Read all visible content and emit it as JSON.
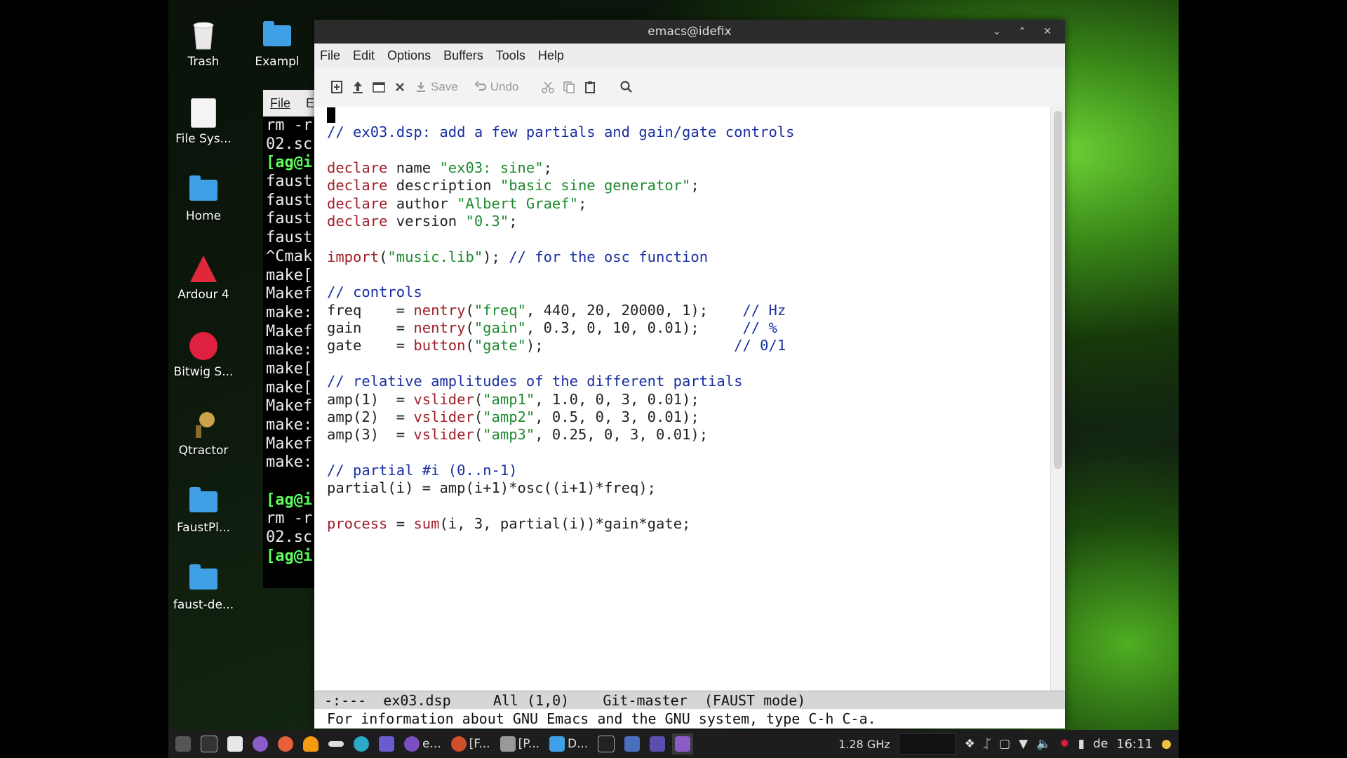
{
  "desktop": {
    "icons": [
      {
        "label": "Trash"
      },
      {
        "label": "Exampl"
      },
      {
        "label": "File Sys..."
      },
      {
        "label": "Home"
      },
      {
        "label": "Ardour 4"
      },
      {
        "label": "Bitwig S..."
      },
      {
        "label": "Qtractor"
      },
      {
        "label": "FaustPl..."
      },
      {
        "label": "faust-de..."
      }
    ]
  },
  "terminal": {
    "menu": [
      "File",
      "E"
    ],
    "lines": [
      "rm -r",
      "02.sc",
      "[ag@i",
      "faust",
      "faust",
      "faust",
      "faust",
      "^Cmak",
      "make[",
      "Makef",
      "make:",
      "Makef",
      "make:",
      "make[",
      "make[",
      "Makef",
      "make:",
      "Makef",
      "make:",
      "",
      "[ag@i",
      "rm -r",
      "02.sc",
      "[ag@i"
    ]
  },
  "emacs": {
    "title": "emacs@idefix",
    "menu": [
      "File",
      "Edit",
      "Options",
      "Buffers",
      "Tools",
      "Help"
    ],
    "toolbar": {
      "save": "Save",
      "undo": "Undo"
    },
    "modeline": "-:---  ex03.dsp     All (1,0)    Git-master  (FAUST mode)",
    "minibuffer": "For information about GNU Emacs and the GNU system, type C-h C-a.",
    "code": {
      "l1": "// ex03.dsp: add a few partials and gain/gate controls",
      "l3a": "declare",
      "l3b": " name ",
      "l3c": "\"ex03: sine\"",
      "l3d": ";",
      "l4a": "declare",
      "l4b": " description ",
      "l4c": "\"basic sine generator\"",
      "l4d": ";",
      "l5a": "declare",
      "l5b": " author ",
      "l5c": "\"Albert Graef\"",
      "l5d": ";",
      "l6a": "declare",
      "l6b": " version ",
      "l6c": "\"0.3\"",
      "l6d": ";",
      "l8a": "import",
      "l8b": "(",
      "l8c": "\"music.lib\"",
      "l8d": "); ",
      "l8e": "// for the osc function",
      "l10": "// controls",
      "l11a": "freq    = ",
      "l11b": "nentry",
      "l11c": "(",
      "l11d": "\"freq\"",
      "l11e": ", 440, 20, 20000, 1);    ",
      "l11f": "// Hz",
      "l12a": "gain    = ",
      "l12b": "nentry",
      "l12c": "(",
      "l12d": "\"gain\"",
      "l12e": ", 0.3, 0, 10, 0.01);     ",
      "l12f": "// %",
      "l13a": "gate    = ",
      "l13b": "button",
      "l13c": "(",
      "l13d": "\"gate\"",
      "l13e": ");                      ",
      "l13f": "// 0/1",
      "l15": "// relative amplitudes of the different partials",
      "l16a": "amp(1)  = ",
      "l16b": "vslider",
      "l16c": "(",
      "l16d": "\"amp1\"",
      "l16e": ", 1.0, 0, 3, 0.01);",
      "l17a": "amp(2)  = ",
      "l17b": "vslider",
      "l17c": "(",
      "l17d": "\"amp2\"",
      "l17e": ", 0.5, 0, 3, 0.01);",
      "l18a": "amp(3)  = ",
      "l18b": "vslider",
      "l18c": "(",
      "l18d": "\"amp3\"",
      "l18e": ", 0.25, 0, 3, 0.01);",
      "l20": "// partial #i (0..n-1)",
      "l21": "partial(i) = amp(i+1)*osc((i+1)*freq);",
      "l23a": "process",
      "l23b": " = ",
      "l23c": "sum",
      "l23d": "(i, 3, partial(i))*gain*gate;"
    }
  },
  "taskbar": {
    "tasks": [
      "e...",
      "[F...",
      "[P...",
      "D..."
    ],
    "cpu": "1.28 GHz",
    "lang": "de",
    "clock": "16:11"
  }
}
